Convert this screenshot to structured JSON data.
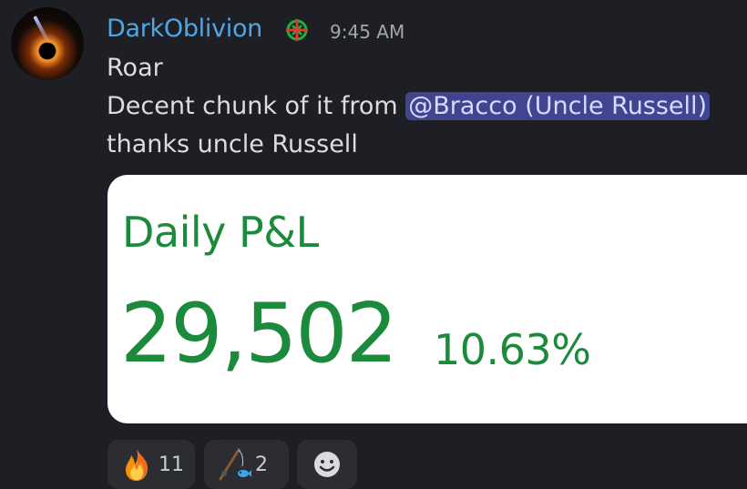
{
  "message": {
    "author": "DarkOblivion",
    "timestamp": "9:45 AM",
    "lines": {
      "line1": "Roar",
      "line2_prefix": "Decent chunk of it from ",
      "mention": "@Bracco (Uncle Russell)",
      "line3": "thanks uncle Russell"
    }
  },
  "embed": {
    "title": "Daily P&L",
    "amount": "29,502",
    "percent": "10.63%",
    "text_color": "#1b8a3b"
  },
  "reactions": [
    {
      "icon": "fire-icon",
      "count": "11"
    },
    {
      "icon": "fishing-icon",
      "count": "2"
    },
    {
      "icon": "add-reaction-icon",
      "count": ""
    }
  ],
  "colors": {
    "background": "#1e1f24",
    "username": "#4fa6e6",
    "mention_bg": "#41458f"
  }
}
